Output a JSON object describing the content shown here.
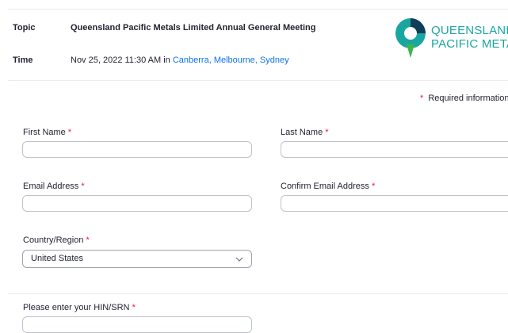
{
  "meeting": {
    "topic_label": "Topic",
    "topic_value": "Queensland Pacific Metals Limited Annual General Meeting",
    "time_label": "Time",
    "time_value": "Nov 25, 2022 11:30 AM",
    "time_in": "in",
    "timezone": "Canberra, Melbourne, Sydney"
  },
  "logo": {
    "line1": "QUEENSLAND",
    "line2": "PACIFIC METALS",
    "colors": {
      "teal": "#1aa6a0",
      "dark": "#0f3f58",
      "green": "#3db54a"
    }
  },
  "form": {
    "required_marker": "*",
    "required_note": "Required information",
    "first_name_label": "First Name",
    "last_name_label": "Last Name",
    "email_label": "Email Address",
    "confirm_email_label": "Confirm Email Address",
    "country_label": "Country/Region",
    "country_value": "United States",
    "hin_label": "Please enter your HIN/SRN"
  },
  "icons": {
    "dropdown": "chevron-down-icon"
  }
}
